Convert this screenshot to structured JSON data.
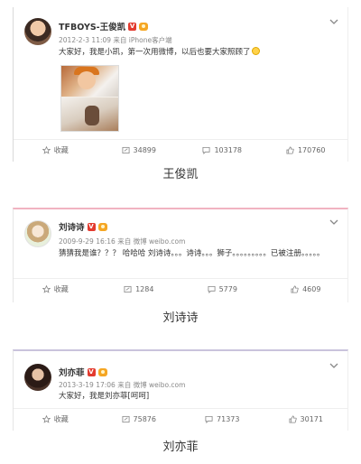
{
  "posts": [
    {
      "name": "TFBOYS-王俊凯",
      "meta": "2012-2-3 11:09 来自 iPhone客户端",
      "text": "大家好，我是小凯，第一次用微博，以后也要大家照顾了",
      "actions": {
        "favorite": "收藏",
        "repost": "34899",
        "comment": "103178",
        "like": "170760"
      },
      "caption": "王俊凯"
    },
    {
      "name": "刘诗诗",
      "meta": "2009-9-29 16:16 来自 微博 weibo.com",
      "text": "猜猜我是谁？？？ 哈哈哈 刘诗诗。。。诗诗。。。狮子。。。。。。。。。已被注册。。。。。",
      "actions": {
        "favorite": "收藏",
        "repost": "1284",
        "comment": "5779",
        "like": "4609"
      },
      "caption": "刘诗诗"
    },
    {
      "name": "刘亦菲",
      "meta": "2013-3-19 17:06 来自 微博 weibo.com",
      "text": "大家好，我是刘亦菲[呵呵]",
      "actions": {
        "favorite": "收藏",
        "repost": "75876",
        "comment": "71373",
        "like": "30171"
      },
      "caption": "刘亦菲"
    }
  ],
  "colors": {
    "v_badge": "#e33b2f",
    "gold_badge": "#f5a623",
    "card2_accent": "#f1b3c1",
    "card3_accent": "#c9c3dc"
  },
  "icons": [
    "star-icon",
    "repost-icon",
    "comment-icon",
    "like-icon",
    "chevron-down-icon"
  ]
}
